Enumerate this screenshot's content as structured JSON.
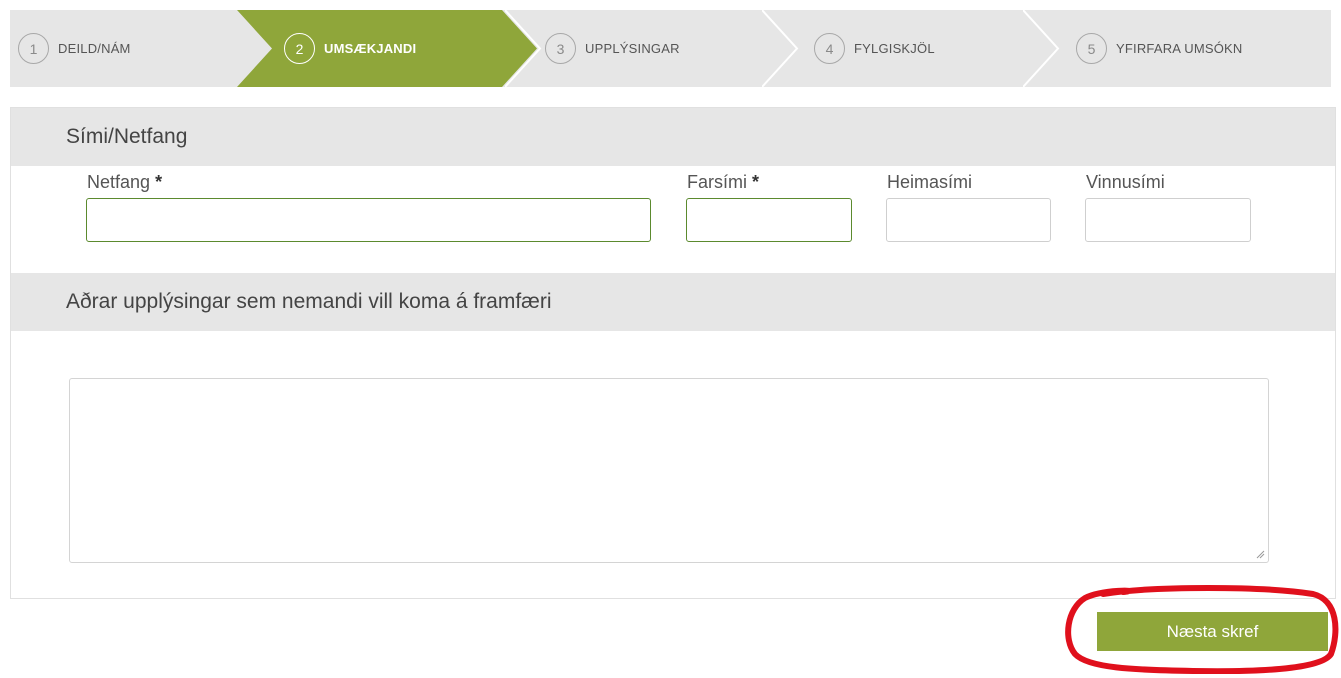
{
  "stepper": {
    "steps": [
      {
        "num": "1",
        "label": "DEILD/NÁM"
      },
      {
        "num": "2",
        "label": "UMSÆKJANDI"
      },
      {
        "num": "3",
        "label": "UPPLÝSINGAR"
      },
      {
        "num": "4",
        "label": "FYLGISKJÖL"
      },
      {
        "num": "5",
        "label": "YFIRFARA UMSÓKN"
      }
    ],
    "active_index": 2
  },
  "contact": {
    "heading": "Sími/Netfang",
    "email_label": "Netfang",
    "mobile_label": "Farsími",
    "home_label": "Heimasími",
    "work_label": "Vinnusími",
    "required_mark": "*"
  },
  "other": {
    "heading": "Aðrar upplýsingar sem nemandi vill koma á framfæri"
  },
  "actions": {
    "next_label": "Næsta skref"
  },
  "colors": {
    "accent": "#8fa63a",
    "highlight": "#e0101c"
  }
}
